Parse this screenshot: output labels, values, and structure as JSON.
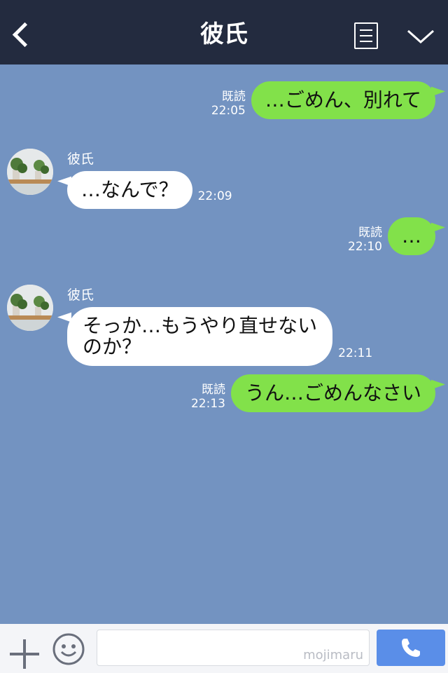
{
  "header": {
    "title": "彼氏",
    "back_icon": "chevron-left-icon",
    "menu_icon": "menu-icon",
    "collapse_icon": "chevron-down-icon"
  },
  "messages": [
    {
      "dir": "out",
      "read": "既読",
      "time": "22:05",
      "text": "…ごめん、別れて"
    },
    {
      "dir": "in",
      "sender": "彼氏",
      "time": "22:09",
      "text": "…なんで？"
    },
    {
      "dir": "out",
      "read": "既読",
      "time": "22:10",
      "text": "…"
    },
    {
      "dir": "in",
      "sender": "彼氏",
      "time": "22:11",
      "text_line1": "そっか…もうやり直せない",
      "text_line2": "のか？"
    },
    {
      "dir": "out",
      "read": "既読",
      "time": "22:13",
      "text": "うん…ごめんなさい"
    }
  ],
  "input_bar": {
    "plus_icon": "plus-icon",
    "sticker_icon": "smile-icon",
    "watermark": "mojimaru",
    "call_icon": "phone-icon"
  },
  "colors": {
    "header_bg": "#232b3f",
    "chat_bg": "#7393c1",
    "out_bubble": "#82e14a",
    "in_bubble": "#ffffff",
    "call_button": "#5a8ee8"
  }
}
